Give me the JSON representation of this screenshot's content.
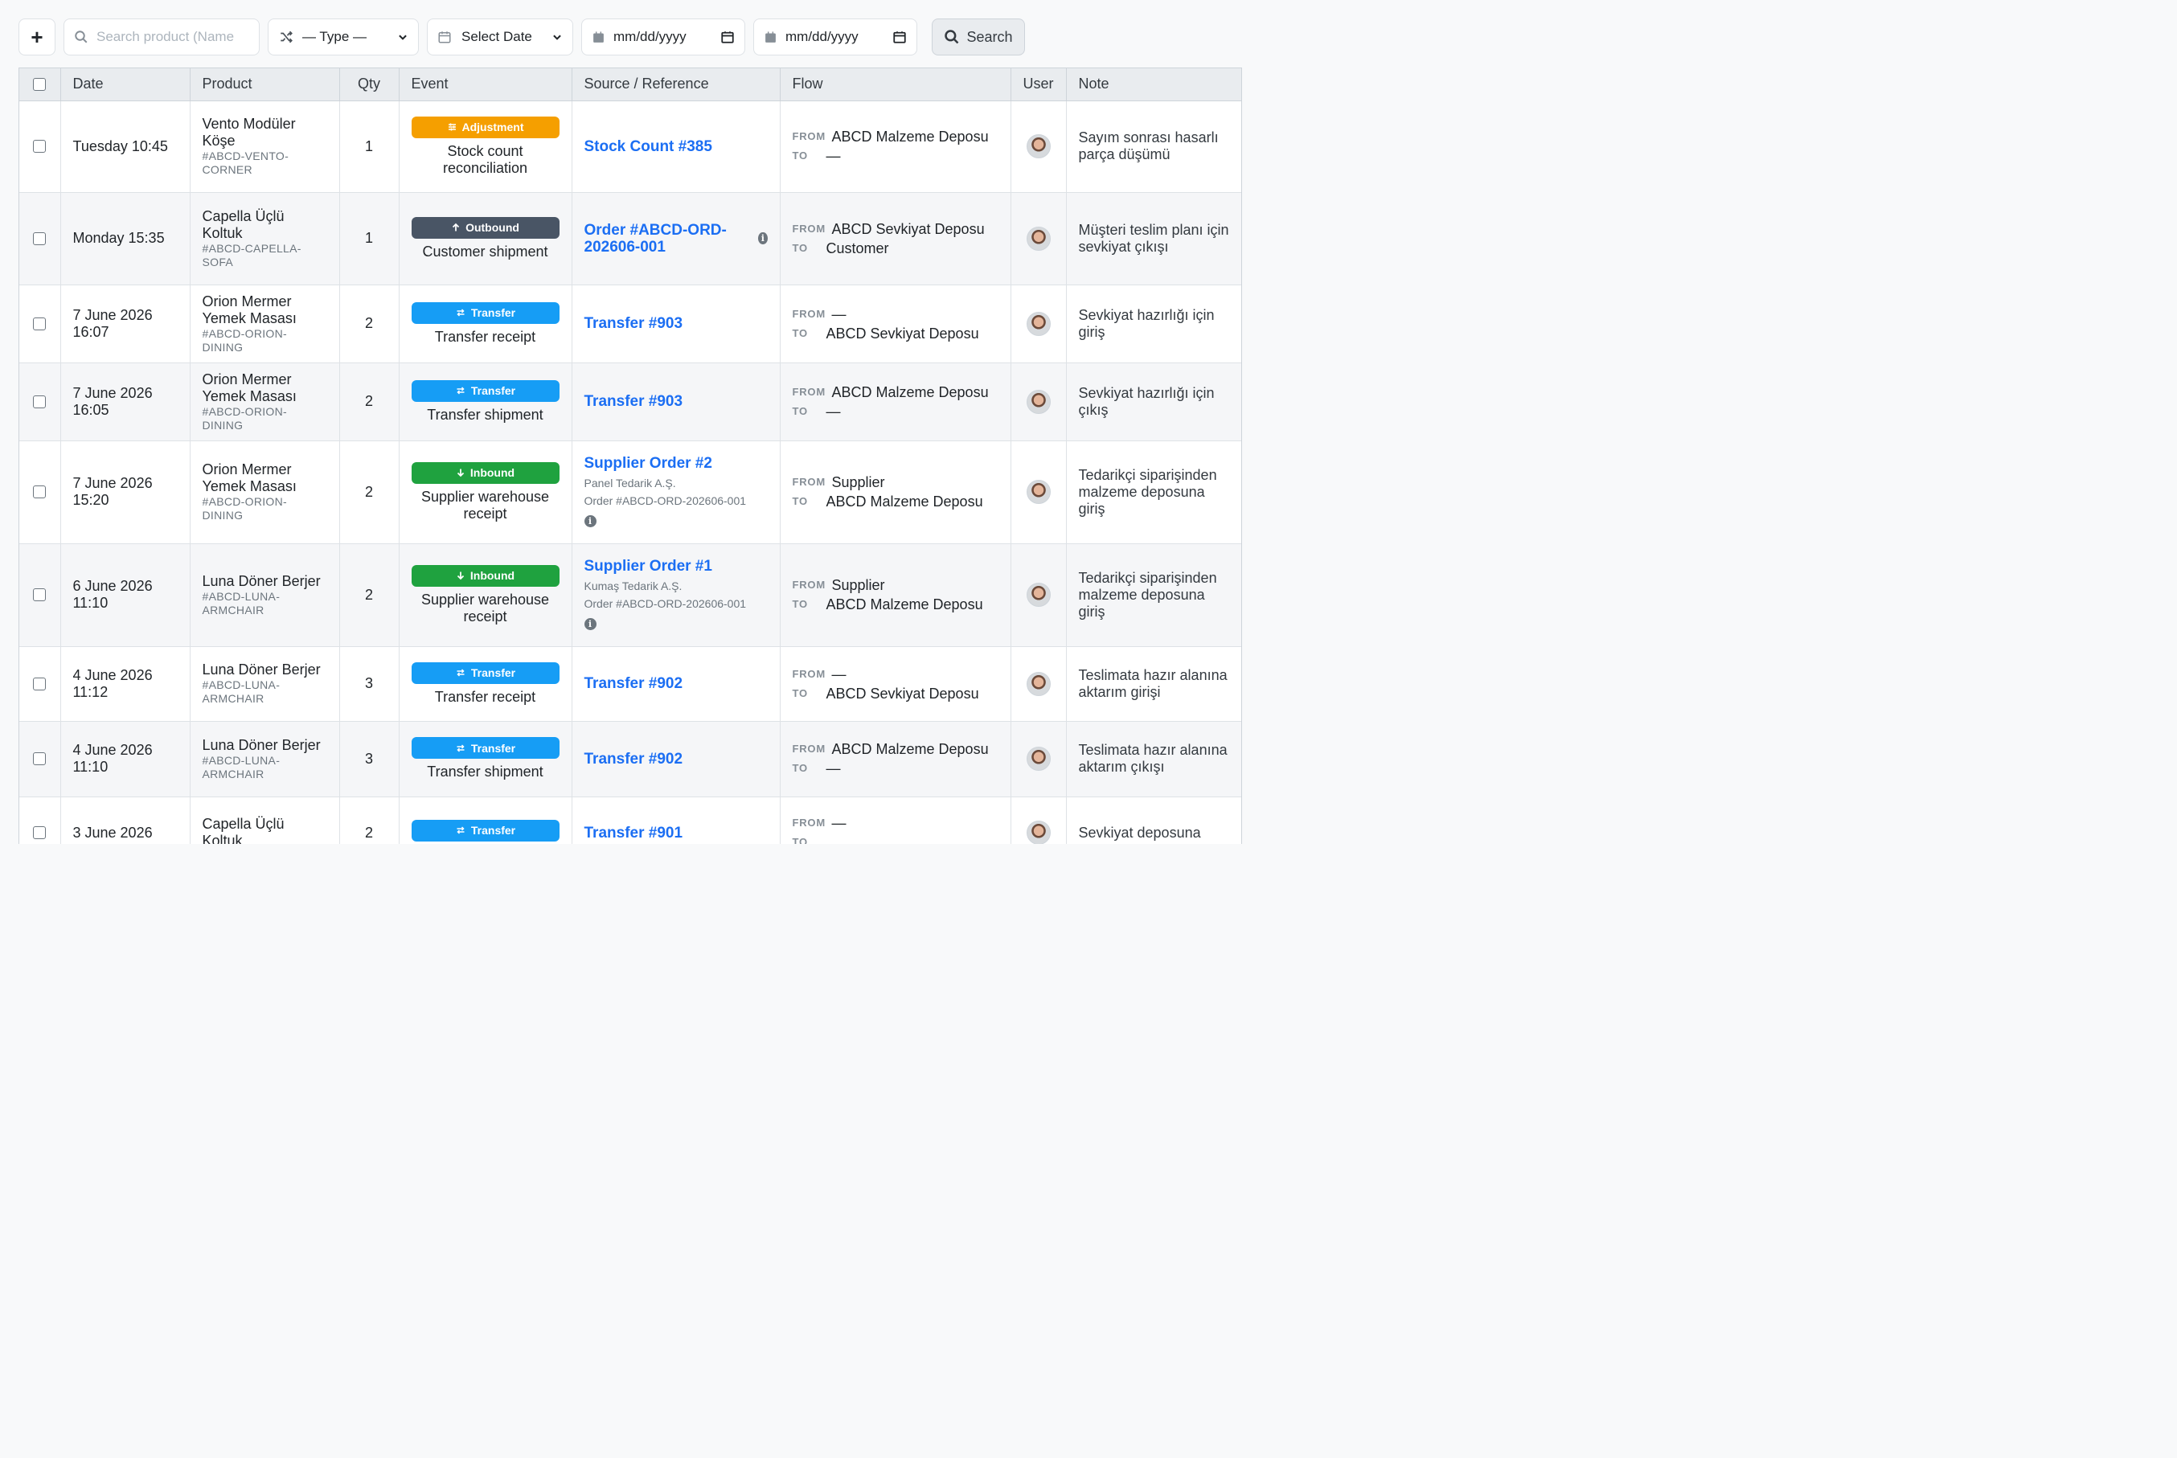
{
  "toolbar": {
    "add_label": "+",
    "search_placeholder": "Search product (Name",
    "type_label": "— Type —",
    "select_date_label": "Select Date",
    "date_from": "mm/dd/yyyy",
    "date_to": "mm/dd/yyyy",
    "search_button": "Search"
  },
  "table": {
    "headers": [
      "Date",
      "Product",
      "Qty",
      "Event",
      "Source / Reference",
      "Flow",
      "User",
      "Note"
    ],
    "flow_from_label": "FROM",
    "flow_to_label": "TO",
    "rows": [
      {
        "date": "Tuesday 10:45",
        "product": "Vento Modüler Köşe",
        "sku": "#ABCD-VENTO-CORNER",
        "qty": "1",
        "badge": "Adjustment",
        "badge_icon": "sliders-icon",
        "event": "Stock count reconciliation",
        "ref": "Stock Count #385",
        "ref_sub1": "",
        "ref_sub2": "",
        "from": "ABCD Malzeme Deposu",
        "to": "—",
        "note": "Sayım sonrası hasarlı parça düşümü"
      },
      {
        "date": "Monday 15:35",
        "product": "Capella Üçlü Koltuk",
        "sku": "#ABCD-CAPELLA-SOFA",
        "qty": "1",
        "badge": "Outbound",
        "badge_icon": "arrow-up-icon",
        "event": "Customer shipment",
        "ref": "Order #ABCD-ORD-202606-001",
        "ref_sub1": "",
        "ref_sub2": "",
        "from": "ABCD Sevkiyat Deposu",
        "to": "Customer",
        "note": "Müşteri teslim planı için sevkiyat çıkışı"
      },
      {
        "date": "7 June 2026 16:07",
        "product": "Orion Mermer Yemek Masası",
        "sku": "#ABCD-ORION-DINING",
        "qty": "2",
        "badge": "Transfer",
        "badge_icon": "swap-icon",
        "event": "Transfer receipt",
        "ref": "Transfer #903",
        "ref_sub1": "",
        "ref_sub2": "",
        "from": "—",
        "to": "ABCD Sevkiyat Deposu",
        "note": "Sevkiyat hazırlığı için giriş"
      },
      {
        "date": "7 June 2026 16:05",
        "product": "Orion Mermer Yemek Masası",
        "sku": "#ABCD-ORION-DINING",
        "qty": "2",
        "badge": "Transfer",
        "badge_icon": "swap-icon",
        "event": "Transfer shipment",
        "ref": "Transfer #903",
        "ref_sub1": "",
        "ref_sub2": "",
        "from": "ABCD Malzeme Deposu",
        "to": "—",
        "note": "Sevkiyat hazırlığı için çıkış"
      },
      {
        "date": "7 June 2026 15:20",
        "product": "Orion Mermer Yemek Masası",
        "sku": "#ABCD-ORION-DINING",
        "qty": "2",
        "badge": "Inbound",
        "badge_icon": "arrow-down-icon",
        "event": "Supplier warehouse receipt",
        "ref": "Supplier Order #2",
        "ref_sub1": "Panel Tedarik A.Ş.",
        "ref_sub2": "Order #ABCD-ORD-202606-001",
        "from": "Supplier",
        "to": "ABCD Malzeme Deposu",
        "note": "Tedarikçi siparişinden malzeme deposuna giriş"
      },
      {
        "date": "6 June 2026 11:10",
        "product": "Luna Döner Berjer",
        "sku": "#ABCD-LUNA-ARMCHAIR",
        "qty": "2",
        "badge": "Inbound",
        "badge_icon": "arrow-down-icon",
        "event": "Supplier warehouse receipt",
        "ref": "Supplier Order #1",
        "ref_sub1": "Kumaş Tedarik A.Ş.",
        "ref_sub2": "Order #ABCD-ORD-202606-001",
        "from": "Supplier",
        "to": "ABCD Malzeme Deposu",
        "note": "Tedarikçi siparişinden malzeme deposuna giriş"
      },
      {
        "date": "4 June 2026 11:12",
        "product": "Luna Döner Berjer",
        "sku": "#ABCD-LUNA-ARMCHAIR",
        "qty": "3",
        "badge": "Transfer",
        "badge_icon": "swap-icon",
        "event": "Transfer receipt",
        "ref": "Transfer #902",
        "ref_sub1": "",
        "ref_sub2": "",
        "from": "—",
        "to": "ABCD Sevkiyat Deposu",
        "note": "Teslimata hazır alanına aktarım girişi"
      },
      {
        "date": "4 June 2026 11:10",
        "product": "Luna Döner Berjer",
        "sku": "#ABCD-LUNA-ARMCHAIR",
        "qty": "3",
        "badge": "Transfer",
        "badge_icon": "swap-icon",
        "event": "Transfer shipment",
        "ref": "Transfer #902",
        "ref_sub1": "",
        "ref_sub2": "",
        "from": "ABCD Malzeme Deposu",
        "to": "—",
        "note": "Teslimata hazır alanına aktarım çıkışı"
      },
      {
        "date": "3 June 2026",
        "product": "Capella Üçlü Koltuk",
        "sku": "",
        "qty": "2",
        "badge": "Transfer",
        "badge_icon": "swap-icon",
        "event": "",
        "ref": "Transfer #901",
        "ref_sub1": "",
        "ref_sub2": "",
        "from": "—",
        "to": "",
        "note": "Sevkiyat deposuna"
      }
    ]
  },
  "colors": {
    "adjustment": "#f59f00",
    "outbound": "#495565",
    "transfer": "#169df5",
    "inbound": "#1fa23f",
    "link": "#1b6ef3"
  }
}
